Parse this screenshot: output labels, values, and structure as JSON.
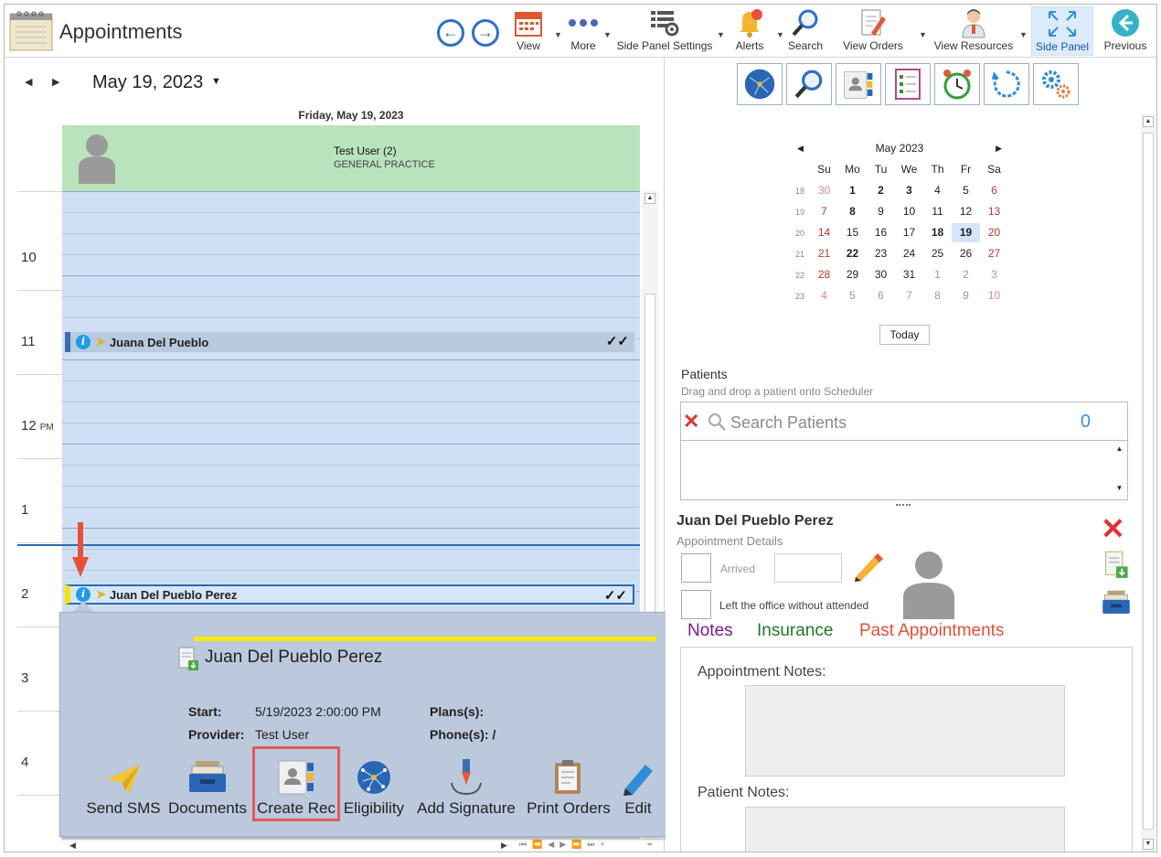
{
  "app": {
    "title": "Appointments"
  },
  "toolbar": {
    "view": "View",
    "more": "More",
    "side_panel_settings": "Side Panel Settings",
    "alerts": "Alerts",
    "search": "Search",
    "view_orders": "View Orders",
    "view_resources": "View Resources",
    "side_panel": "Side Panel",
    "previous": "Previous"
  },
  "scheduler": {
    "date": "May 19, 2023",
    "day_header": "Friday, May 19, 2023",
    "resource": {
      "name": "Test User (2)",
      "specialty": "GENERAL PRACTICE"
    },
    "times": [
      {
        "hour": "10",
        "suffix": ""
      },
      {
        "hour": "11",
        "suffix": ""
      },
      {
        "hour": "12",
        "suffix": "PM"
      },
      {
        "hour": "1",
        "suffix": ""
      },
      {
        "hour": "2",
        "suffix": ""
      },
      {
        "hour": "3",
        "suffix": ""
      },
      {
        "hour": "4",
        "suffix": ""
      }
    ],
    "appointments": [
      {
        "patient": "Juana Del Pueblo",
        "checks": "✓✓"
      },
      {
        "patient": "Juan Del Pueblo Perez",
        "checks": "✓✓"
      }
    ]
  },
  "popup": {
    "title": "Juan Del Pueblo Perez",
    "start_label": "Start:",
    "start_value": "5/19/2023 2:00:00 PM",
    "provider_label": "Provider:",
    "provider_value": "Test User",
    "plans_label": "Plans(s):",
    "phone_label": "Phone(s): /",
    "actions": [
      "Send SMS",
      "Documents",
      "Create Rec",
      "Eligibility",
      "Add Signature",
      "Print Orders",
      "Edit"
    ]
  },
  "calendar": {
    "month": "May 2023",
    "dow": [
      "Su",
      "Mo",
      "Tu",
      "We",
      "Th",
      "Fr",
      "Sa"
    ],
    "weeks": [
      {
        "wk": "18",
        "days": [
          "30",
          "1",
          "2",
          "3",
          "4",
          "5",
          "6"
        ]
      },
      {
        "wk": "19",
        "days": [
          "7",
          "8",
          "9",
          "10",
          "11",
          "12",
          "13"
        ]
      },
      {
        "wk": "20",
        "days": [
          "14",
          "15",
          "16",
          "17",
          "18",
          "19",
          "20"
        ]
      },
      {
        "wk": "21",
        "days": [
          "21",
          "22",
          "23",
          "24",
          "25",
          "26",
          "27"
        ]
      },
      {
        "wk": "22",
        "days": [
          "28",
          "29",
          "30",
          "31",
          "1",
          "2",
          "3"
        ]
      },
      {
        "wk": "23",
        "days": [
          "4",
          "5",
          "6",
          "7",
          "8",
          "9",
          "10"
        ]
      }
    ],
    "today_label": "Today"
  },
  "patients": {
    "heading": "Patients",
    "subheading": "Drag and drop a patient onto Scheduler",
    "search_placeholder": "Search Patients",
    "count": "0"
  },
  "details": {
    "name": "Juan Del Pueblo Perez",
    "subtitle": "Appointment Details",
    "arrived_label": "Arrived",
    "left_label": "Left the office without attended"
  },
  "tabs": [
    {
      "label": "Notes",
      "color": "#7a1f8a"
    },
    {
      "label": "Insurance",
      "color": "#1d7a2a"
    },
    {
      "label": "Past Appointments",
      "color": "#e0503a"
    }
  ],
  "notes": {
    "appointment_notes_label": "Appointment Notes:",
    "patient_notes_label": "Patient Notes:"
  }
}
